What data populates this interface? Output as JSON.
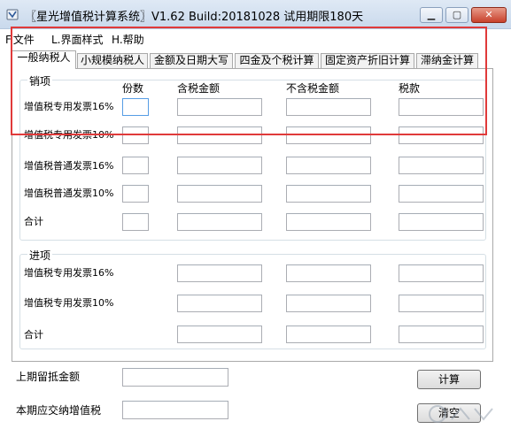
{
  "window": {
    "title": "〖星光增值税计算系统〗V1.62 Build:20181028 试用期限180天",
    "minimize_glyph": "▁",
    "maximize_glyph": "▢",
    "close_glyph": "✕"
  },
  "menu": {
    "file": "F.文件",
    "style": "L.界面样式",
    "help": "H.帮助"
  },
  "tabs": [
    "一般纳税人",
    "小规模纳税人",
    "金额及日期大写",
    "四金及个税计算",
    "固定资产折旧计算",
    "滞纳金计算"
  ],
  "sales": {
    "group_label": "销项",
    "columns": [
      "份数",
      "含税金额",
      "不含税金额",
      "税款"
    ],
    "rows": [
      "增值税专用发票16%",
      "增值税专用发票10%",
      "增值税普通发票16%",
      "增值税普通发票10%",
      "合计"
    ]
  },
  "purchase": {
    "group_label": "进项",
    "rows": [
      "增值税专用发票16%",
      "增值税专用发票10%",
      "合计"
    ]
  },
  "bottom": {
    "carryover_label": "上期留抵金额",
    "payable_label": "本期应交纳增值税",
    "calculate_label": "计算",
    "clear_label": "清空"
  },
  "colors": {
    "highlight": "#e03a3a",
    "titlebar": "#c9d9ec",
    "focus_border": "#569de5"
  }
}
